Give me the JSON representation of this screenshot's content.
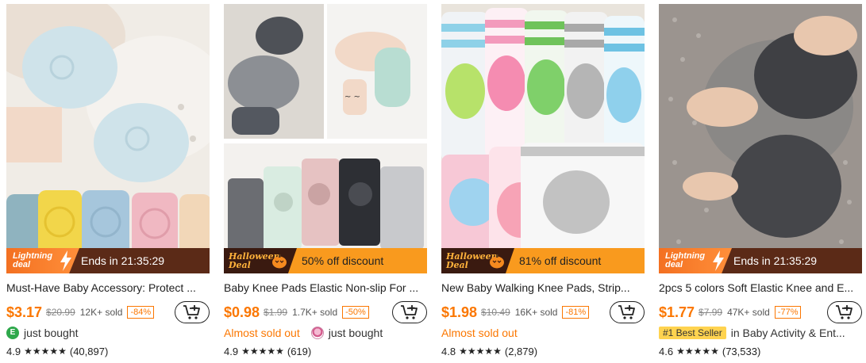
{
  "products": [
    {
      "banner_type": "lightning",
      "banner_tag": "Lightning deal",
      "banner_text": "Ends in 21:35:29",
      "title": "Must-Have Baby Accessory: Protect ...",
      "price": "$3.17",
      "original_price": "$20.99",
      "sold": "12K+ sold",
      "discount": "-84%",
      "activity": "just bought",
      "activity_avatar": "E",
      "rating": "4.9",
      "stars": "★★★★★",
      "reviews": "(40,897)"
    },
    {
      "banner_type": "halloween",
      "banner_tag": "Halloween Deal",
      "banner_text": "50% off discount",
      "title": "Baby Knee Pads Elastic Non-slip For ...",
      "price": "$0.98",
      "original_price": "$1.99",
      "sold": "1.7K+ sold",
      "discount": "-50%",
      "status": "Almost sold out",
      "activity": "just bought",
      "rating": "4.9",
      "stars": "★★★★★",
      "reviews": "(619)"
    },
    {
      "banner_type": "halloween",
      "banner_tag": "Halloween Deal",
      "banner_text": "81% off discount",
      "title": "New Baby Walking Knee Pads, Strip...",
      "price": "$1.98",
      "original_price": "$10.49",
      "sold": "16K+ sold",
      "discount": "-81%",
      "status": "Almost sold out",
      "rating": "4.8",
      "stars": "★★★★★",
      "reviews": "(2,879)"
    },
    {
      "banner_type": "lightning",
      "banner_tag": "Lightning deal",
      "banner_text": "Ends in 21:35:29",
      "title": "2pcs 5 colors Soft Elastic Knee and E...",
      "price": "$1.77",
      "original_price": "$7.99",
      "sold": "47K+ sold",
      "discount": "-77%",
      "best_seller": "#1 Best Seller",
      "best_seller_category": "in Baby Activity & Ent...",
      "rating": "4.6",
      "stars": "★★★★★",
      "reviews": "(73,533)"
    }
  ],
  "colors": {
    "accent": "#fb7701",
    "lightning_bg": "#5b2a17",
    "halloween_bg": "#f99a1e",
    "best_seller_bg": "#ffd34f"
  },
  "icons": {
    "cart": "add-to-cart-icon",
    "lightning": "lightning-bolt-icon",
    "halloween": "pumpkin-icon"
  }
}
